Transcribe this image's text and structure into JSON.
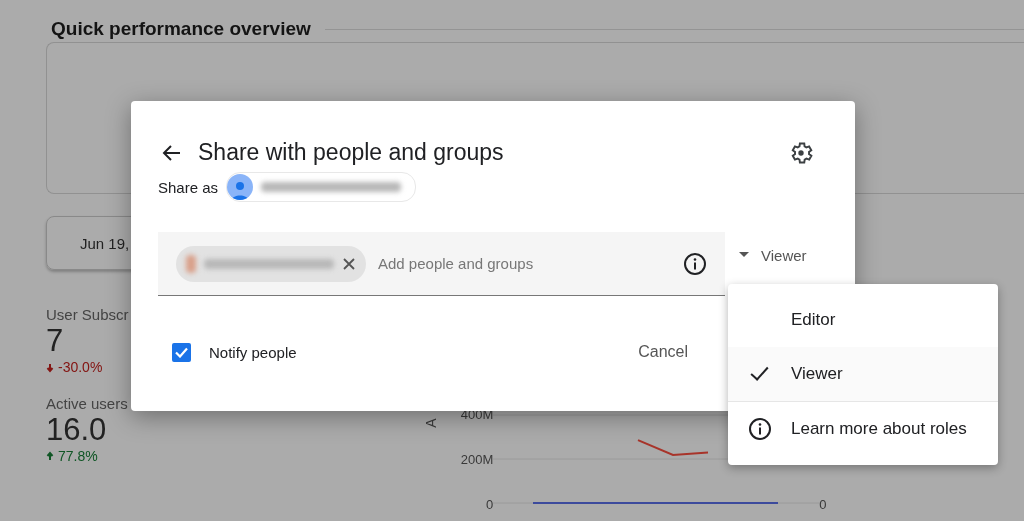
{
  "background": {
    "section_title": "Quick performance overview",
    "date_button": "Jun 19,",
    "metrics": [
      {
        "label": "User Subscr",
        "value": "7",
        "change": "-30.0%",
        "kind": "down"
      },
      {
        "label": "Active users",
        "value": "16.0",
        "change": "77.8%",
        "kind": "up"
      }
    ],
    "chart": {
      "axis_label": "A",
      "right_ticks": [
        "0"
      ],
      "chart_data": {
        "type": "line",
        "ylim": [
          0,
          400000000
        ],
        "yticks": [
          {
            "value": 400000000,
            "label": "400M"
          },
          {
            "value": 200000000,
            "label": "200M"
          },
          {
            "value": 0,
            "label": "0"
          }
        ],
        "series": [
          {
            "color": "#a8342a",
            "values": [
              null,
              null,
              null,
              286000000,
              218000000,
              230000000,
              null,
              null
            ]
          },
          {
            "color": "#3c4a9c",
            "values": [
              0,
              0,
              0,
              0,
              0,
              0,
              0,
              0
            ]
          }
        ]
      }
    }
  },
  "dialog": {
    "title": "Share with people and groups",
    "share_as_label": "Share as",
    "input_placeholder": "Add people and groups",
    "role_button": "Viewer",
    "notify": {
      "label": "Notify people",
      "checked": true
    },
    "cancel_button": "Cancel"
  },
  "role_menu": {
    "items": [
      {
        "label": "Editor",
        "selected": false
      },
      {
        "label": "Viewer",
        "selected": true
      }
    ],
    "help_item": "Learn more about roles"
  }
}
